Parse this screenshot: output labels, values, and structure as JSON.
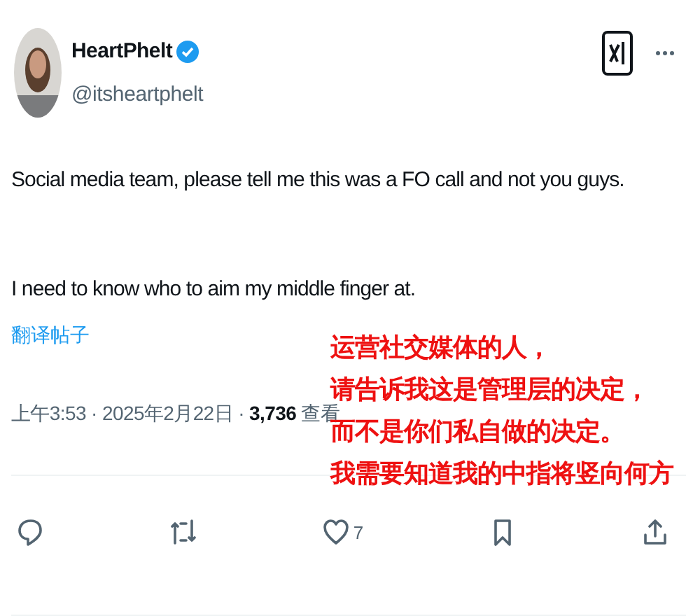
{
  "author": {
    "name": "HeartPhelt",
    "handle": "@itsheartphelt",
    "verified": true
  },
  "post": {
    "paragraphs": [
      "Social media team, please tell me this was a FO call and not you guys.",
      "I need to know who to aim my middle finger at."
    ],
    "translate_link": "翻译帖子",
    "meta": "上午3:53 · 2025年2月22日 · **3,736** 查看"
  },
  "overlay": {
    "lines": [
      "运营社交媒体的人，",
      "请告诉我这是管理层的决定，",
      "而不是你们私自做的决定。",
      "我需要知道我的中指将竖向何方"
    ]
  },
  "actions": [
    {
      "kind": "reply"
    },
    {
      "kind": "repost"
    },
    {
      "kind": "like",
      "count": "7"
    },
    {
      "kind": "bookmark"
    },
    {
      "kind": "share"
    }
  ]
}
